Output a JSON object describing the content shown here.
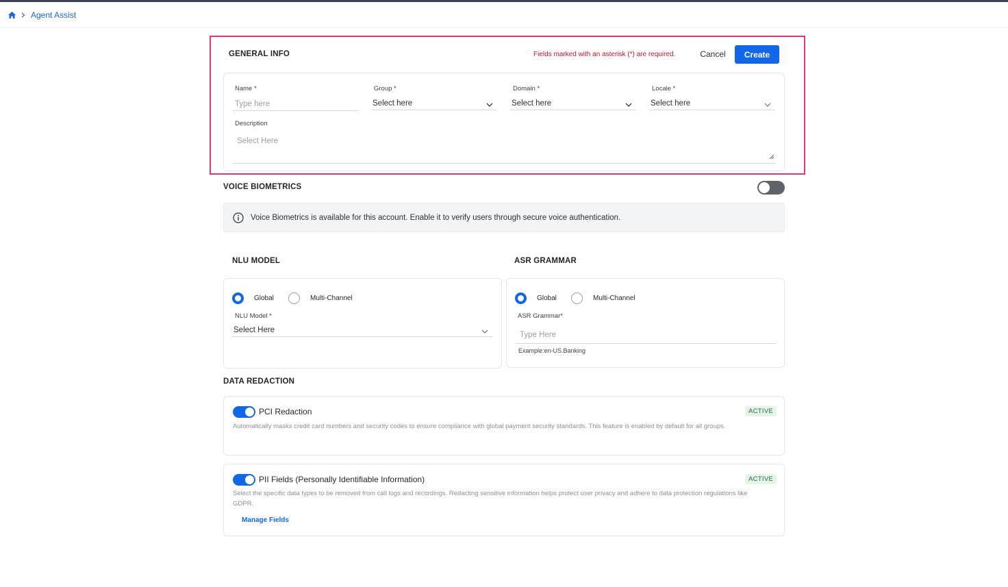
{
  "breadcrumb": {
    "current": "Agent Assist"
  },
  "general_info": {
    "title": "GENERAL INFO",
    "required_note": "Fields marked with an asterisk (*) are required.",
    "cancel_label": "Cancel",
    "create_label": "Create",
    "fields": {
      "name": {
        "label": "Name *",
        "placeholder": "Type here"
      },
      "group": {
        "label": "Group *",
        "value": "Select here"
      },
      "domain": {
        "label": "Domain *",
        "value": "Select here"
      },
      "locale": {
        "label": "Locale *",
        "value": "Select here"
      },
      "description": {
        "label": "Description",
        "placeholder": "Select Here"
      }
    }
  },
  "voice_biometrics": {
    "title": "VOICE BIOMETRICS",
    "enabled": false,
    "info": "Voice Biometrics is available for this account. Enable it to verify users through secure voice authentication."
  },
  "nlu_model": {
    "title": "NLU MODEL",
    "options": [
      "Global",
      "Multi-Channel"
    ],
    "selected": "Global",
    "field_label": "NLU Model *",
    "field_value": "Select Here"
  },
  "asr_grammar": {
    "title": "ASR GRAMMAR",
    "options": [
      "Global",
      "Multi-Channel"
    ],
    "selected": "Global",
    "field_label": "ASR Grammar*",
    "placeholder": "Type Here",
    "example": "Example:en-US.Banking"
  },
  "data_redaction": {
    "title": "DATA REDACTION",
    "items": [
      {
        "name": "PCI Redaction",
        "status": "ACTIVE",
        "enabled": true,
        "description": "Automatically masks credit card numbers and security codes to ensure compliance with global payment security standards. This feature is enabled by default for all groups."
      },
      {
        "name": "PII Fields (Personally Identifiable Information)",
        "status": "ACTIVE",
        "enabled": true,
        "description": "Select the specific data types to be removed from call logs and recordings. Redacting sensitive information helps protect user privacy and adhere to data protection regulations like GDPR.",
        "link": "Manage Fields"
      }
    ]
  },
  "colors": {
    "primary": "#1167e8",
    "required": "#c0172b",
    "focus": "#d63a7a",
    "active_badge": "#e6f4ea"
  },
  "icons": {
    "home": "home-icon",
    "breadcrumb_separator": "chevron-right-icon",
    "dropdown": "chevron-down-icon",
    "info": "info-icon",
    "resize": "resize-handle-icon"
  }
}
